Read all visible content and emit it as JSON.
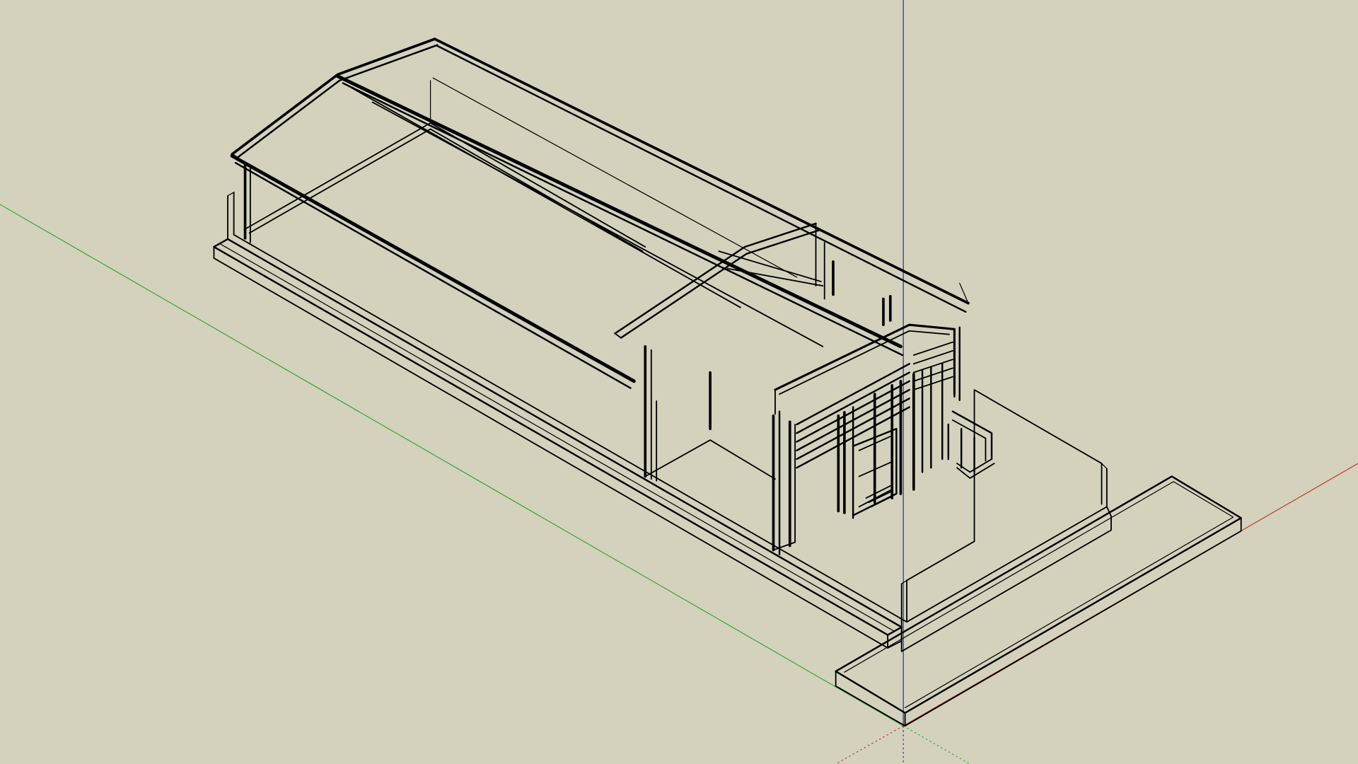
{
  "viewport": {
    "background": "#d4d2bd",
    "edge_color": "#000000"
  },
  "axes": {
    "red": "#c0392b",
    "green": "#3aa63a",
    "blue": "#2a2aa8"
  },
  "model": {
    "type": "building-wireframe",
    "style": "x-ray / hidden-line"
  }
}
